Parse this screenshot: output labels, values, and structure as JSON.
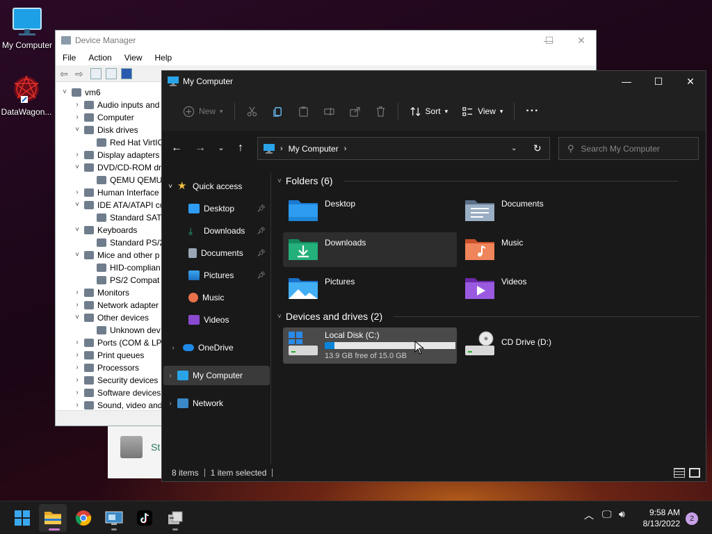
{
  "desktop": {
    "icons": [
      {
        "label": "My Computer"
      },
      {
        "label": "DataWagon..."
      }
    ]
  },
  "device_manager": {
    "title": "Device Manager",
    "menu": [
      "File",
      "Action",
      "View",
      "Help"
    ],
    "tree": [
      {
        "label": "vm6",
        "indent": 0,
        "chev": "˅"
      },
      {
        "label": "Audio inputs and",
        "indent": 1,
        "chev": "›"
      },
      {
        "label": "Computer",
        "indent": 1,
        "chev": "›"
      },
      {
        "label": "Disk drives",
        "indent": 1,
        "chev": "˅"
      },
      {
        "label": "Red Hat VirtIO",
        "indent": 2,
        "chev": ""
      },
      {
        "label": "Display adapters",
        "indent": 1,
        "chev": "›"
      },
      {
        "label": "DVD/CD-ROM dr",
        "indent": 1,
        "chev": "˅"
      },
      {
        "label": "QEMU QEMU",
        "indent": 2,
        "chev": ""
      },
      {
        "label": "Human Interface",
        "indent": 1,
        "chev": "›"
      },
      {
        "label": "IDE ATA/ATAPI co",
        "indent": 1,
        "chev": "˅"
      },
      {
        "label": "Standard SATA",
        "indent": 2,
        "chev": ""
      },
      {
        "label": "Keyboards",
        "indent": 1,
        "chev": "˅"
      },
      {
        "label": "Standard PS/2",
        "indent": 2,
        "chev": ""
      },
      {
        "label": "Mice and other p",
        "indent": 1,
        "chev": "˅"
      },
      {
        "label": "HID-complian",
        "indent": 2,
        "chev": ""
      },
      {
        "label": "PS/2 Compat",
        "indent": 2,
        "chev": ""
      },
      {
        "label": "Monitors",
        "indent": 1,
        "chev": "›"
      },
      {
        "label": "Network adapter",
        "indent": 1,
        "chev": "›"
      },
      {
        "label": "Other devices",
        "indent": 1,
        "chev": "˅"
      },
      {
        "label": "Unknown dev",
        "indent": 2,
        "chev": ""
      },
      {
        "label": "Ports (COM & LP",
        "indent": 1,
        "chev": "›"
      },
      {
        "label": "Print queues",
        "indent": 1,
        "chev": "›"
      },
      {
        "label": "Processors",
        "indent": 1,
        "chev": "›"
      },
      {
        "label": "Security devices",
        "indent": 1,
        "chev": "›"
      },
      {
        "label": "Software devices",
        "indent": 1,
        "chev": "›"
      },
      {
        "label": "Sound, video and",
        "indent": 1,
        "chev": "›"
      }
    ]
  },
  "behind_window": {
    "label": "St"
  },
  "explorer": {
    "title": "My Computer",
    "toolbar": {
      "new": "New",
      "sort": "Sort",
      "view": "View",
      "more": "···"
    },
    "address": {
      "location": "My Computer",
      "search_placeholder": "Search My Computer"
    },
    "nav": {
      "quick_access": "Quick access",
      "items": [
        "Desktop",
        "Downloads",
        "Documents",
        "Pictures",
        "Music",
        "Videos"
      ],
      "onedrive": "OneDrive",
      "my_computer": "My Computer",
      "network": "Network"
    },
    "folders_header": "Folders (6)",
    "folders": [
      "Desktop",
      "Documents",
      "Downloads",
      "Music",
      "Pictures",
      "Videos"
    ],
    "devices_header": "Devices and drives (2)",
    "drives": [
      {
        "name": "Local Disk (C:)",
        "free": "13.9 GB free of 15.0 GB",
        "used_fraction": 0.073
      },
      {
        "name": "CD Drive (D:)"
      }
    ],
    "status": {
      "items": "8 items",
      "selected": "1 item selected"
    }
  },
  "taskbar": {
    "time": "9:58 AM",
    "date": "8/13/2022",
    "notification_count": "2"
  },
  "colors": {
    "accent": "#0a84d8",
    "folder_blue": "#2e9cf0",
    "download_green": "#24b07a"
  }
}
